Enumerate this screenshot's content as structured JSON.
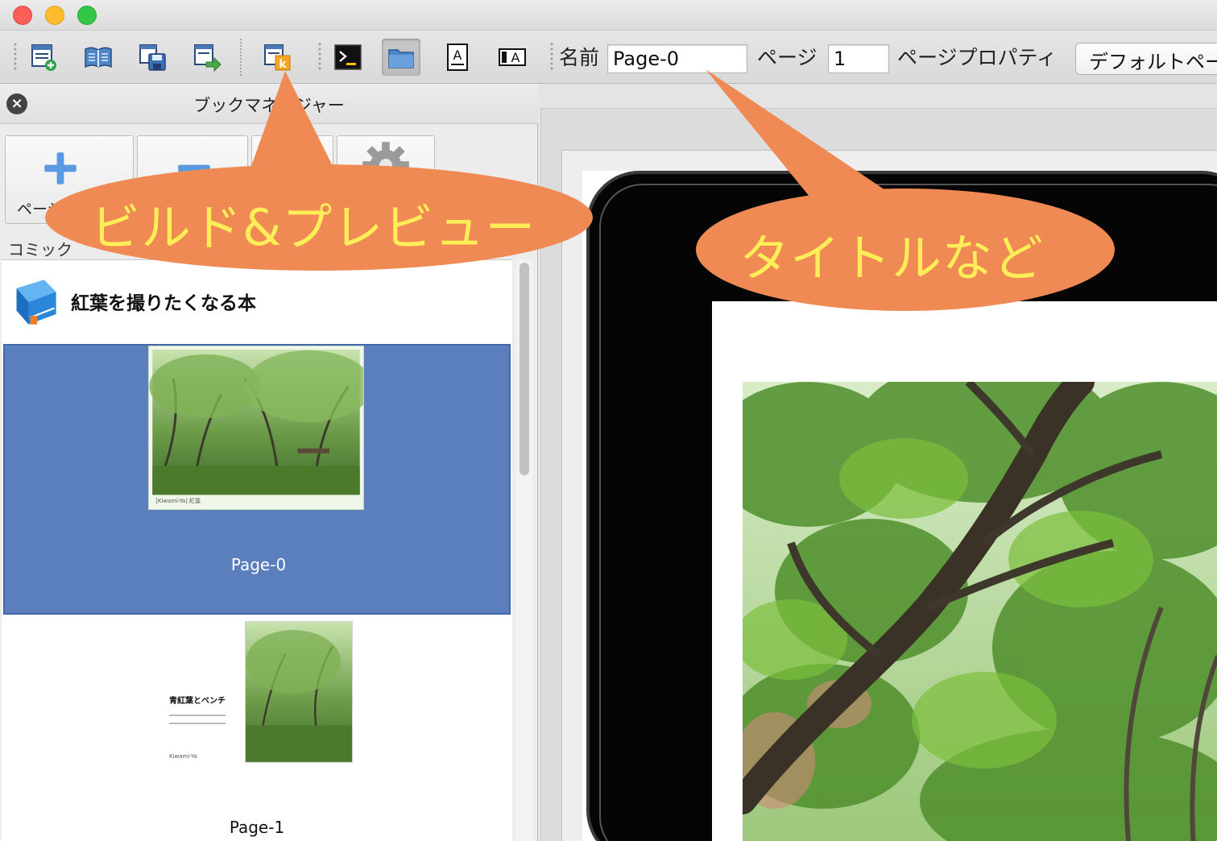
{
  "window": {
    "traffic_lights": {
      "close": "#fc5f57",
      "minimize": "#fdbc2e",
      "zoom": "#33c748"
    }
  },
  "toolbar": {
    "icons": [
      "new-page-icon",
      "book-icon",
      "save-icon",
      "export-icon",
      "build-preview-icon",
      "terminal-icon",
      "folder-icon",
      "text-frame-icon",
      "text-box-icon"
    ],
    "name_label": "名前",
    "name_value": "Page-0",
    "page_label": "ページ",
    "page_value": "1",
    "page_property_label": "ページプロパティ",
    "page_property_value": "デフォルトページ"
  },
  "book_manager": {
    "title": "ブックマネージャー",
    "add_page_label": "ページ",
    "section_label": "コミック",
    "book_title": "紅葉を撮りたくなる本",
    "pages": [
      {
        "label": "Page-0",
        "selected": true,
        "thumb_caption": "[Kiwami-Ya] 紅葉"
      },
      {
        "label": "Page-1",
        "selected": false,
        "heading": "青紅葉とベンチ",
        "thumb_caption": "Kiwami-Ya"
      }
    ],
    "selection_color": "#5b7fbd"
  },
  "callouts": {
    "build_preview": "ビルド&プレビュー",
    "title_etc": "タイトルなど",
    "color": "#ef8a55",
    "text_color": "#ffee58"
  }
}
